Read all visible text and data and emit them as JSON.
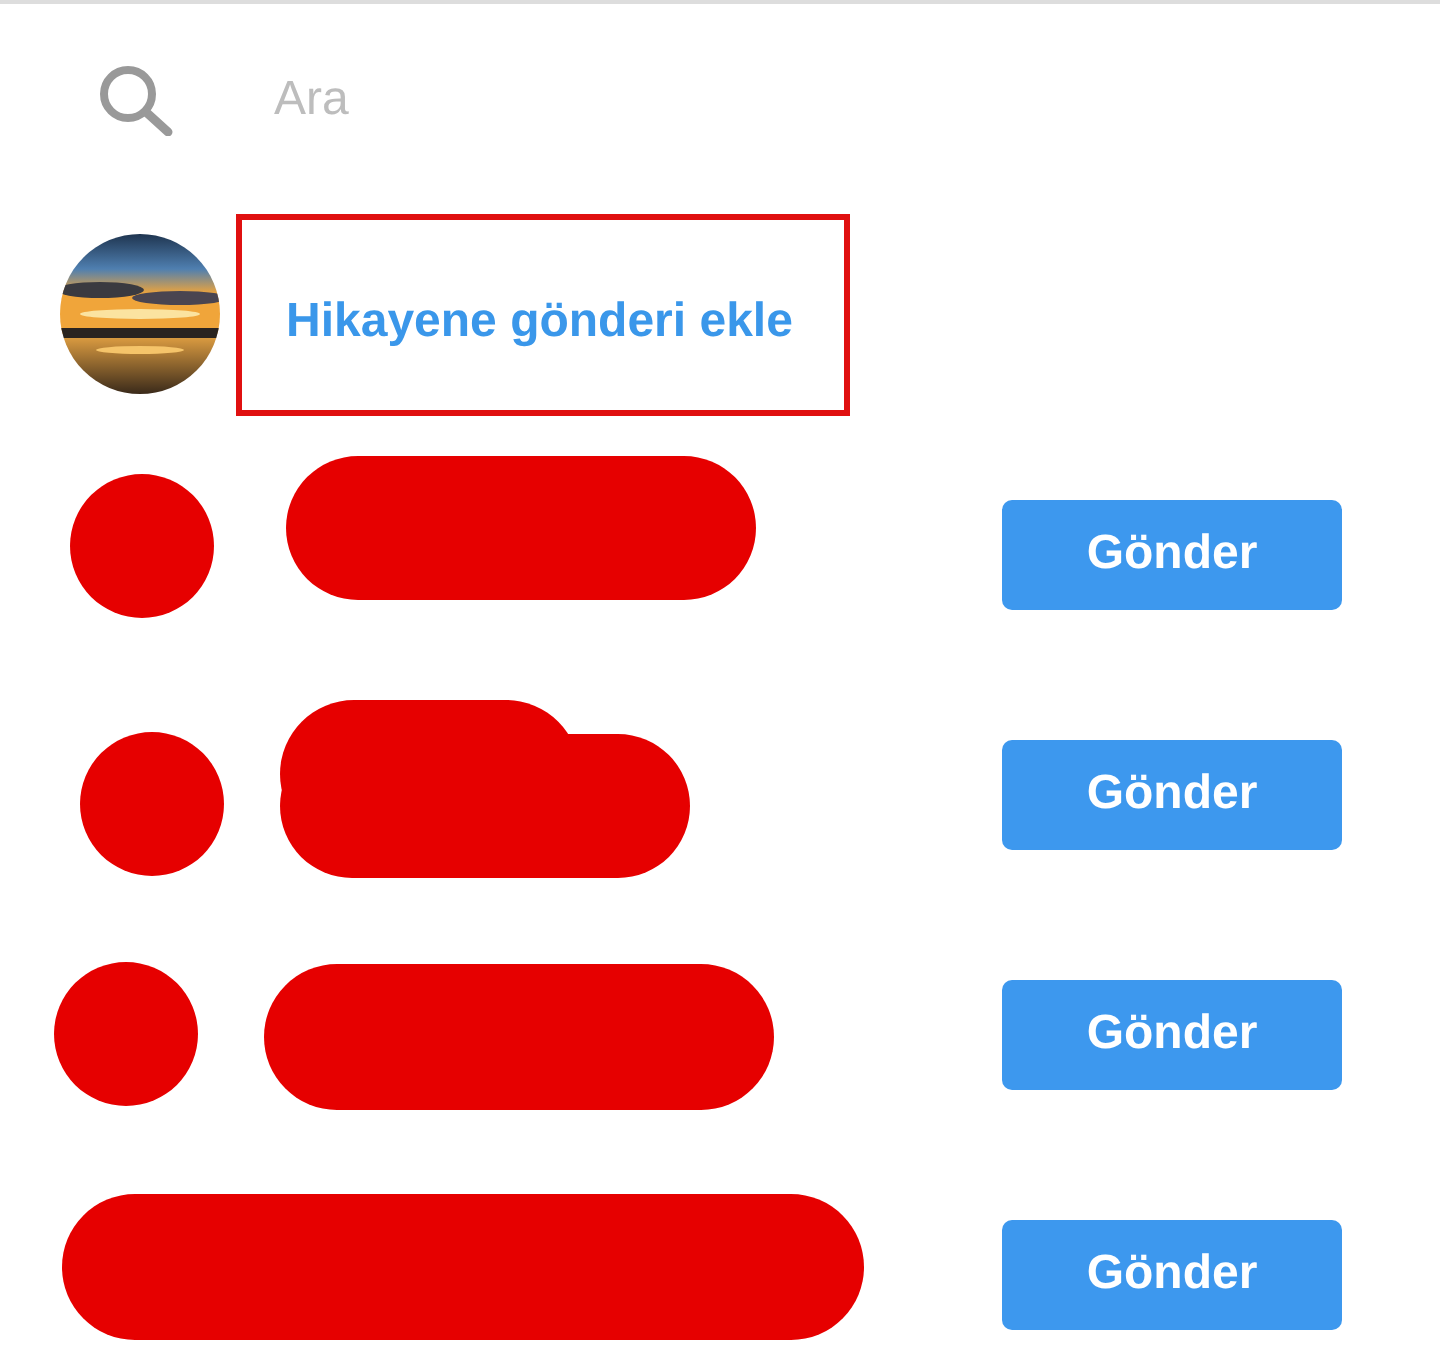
{
  "search": {
    "placeholder": "Ara"
  },
  "story": {
    "label": "Hikayene gönderi ekle",
    "highlighted": true
  },
  "recipients": [
    {
      "button": "Gönder"
    },
    {
      "button": "Gönder"
    },
    {
      "button": "Gönder"
    },
    {
      "button": "Gönder"
    }
  ]
}
